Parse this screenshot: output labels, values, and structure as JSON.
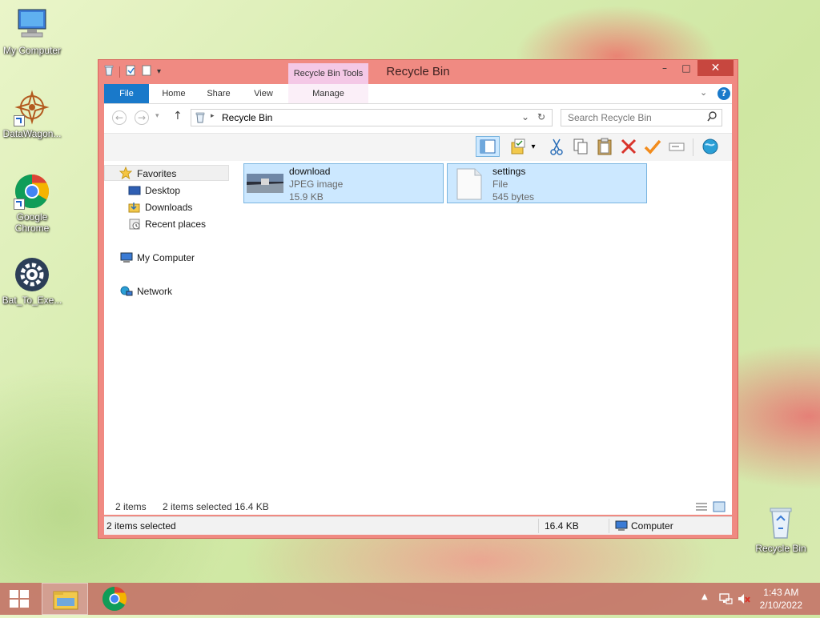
{
  "desktop": {
    "icons": [
      {
        "label": "My Computer"
      },
      {
        "label": "DataWagon..."
      },
      {
        "label": "Google Chrome"
      },
      {
        "label": "Bat_To_Exe..."
      },
      {
        "label": "Recycle Bin"
      }
    ]
  },
  "window": {
    "title": "Recycle Bin",
    "contextual_tab_group": "Recycle Bin Tools",
    "controls": {
      "minimize": "–",
      "maximize": "□",
      "close": "✕"
    },
    "ribbon_tabs": [
      "File",
      "Home",
      "Share",
      "View",
      "Manage"
    ],
    "address": {
      "path": "Recycle Bin",
      "search_placeholder": "Search Recycle Bin"
    },
    "nav_pane": {
      "favorites": "Favorites",
      "favorites_items": [
        "Desktop",
        "Downloads",
        "Recent places"
      ],
      "computer": "My Computer",
      "network": "Network"
    },
    "files": [
      {
        "name": "download",
        "type": "JPEG image",
        "size": "15.9 KB"
      },
      {
        "name": "settings",
        "type": "File",
        "size": "545 bytes"
      }
    ],
    "footer": {
      "count": "2 items",
      "selected": "2 items selected",
      "size": "16.4 KB"
    },
    "statusbar": {
      "text": "2 items selected",
      "size": "16.4 KB",
      "location": "Computer"
    }
  },
  "taskbar": {
    "time": "1:43 AM",
    "date": "2/10/2022"
  },
  "colors": {
    "window_frame": "#f08a82",
    "close_button": "#c7473f",
    "file_tab": "#1979ca",
    "selection": "#cce8ff",
    "taskbar": "#c47669"
  }
}
